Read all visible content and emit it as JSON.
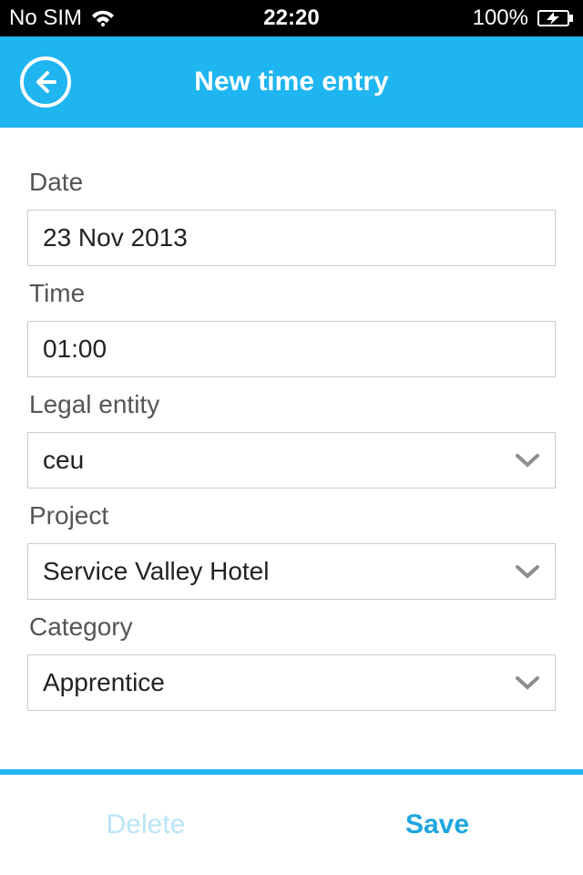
{
  "status": {
    "carrier": "No SIM",
    "time": "22:20",
    "battery": "100%"
  },
  "nav": {
    "title": "New time entry"
  },
  "form": {
    "date": {
      "label": "Date",
      "value": "23 Nov 2013"
    },
    "time": {
      "label": "Time",
      "value": "01:00"
    },
    "legal_entity": {
      "label": "Legal entity",
      "value": "ceu"
    },
    "project": {
      "label": "Project",
      "value": "Service Valley Hotel"
    },
    "category": {
      "label": "Category",
      "value": "Apprentice"
    }
  },
  "footer": {
    "delete": "Delete",
    "save": "Save"
  }
}
